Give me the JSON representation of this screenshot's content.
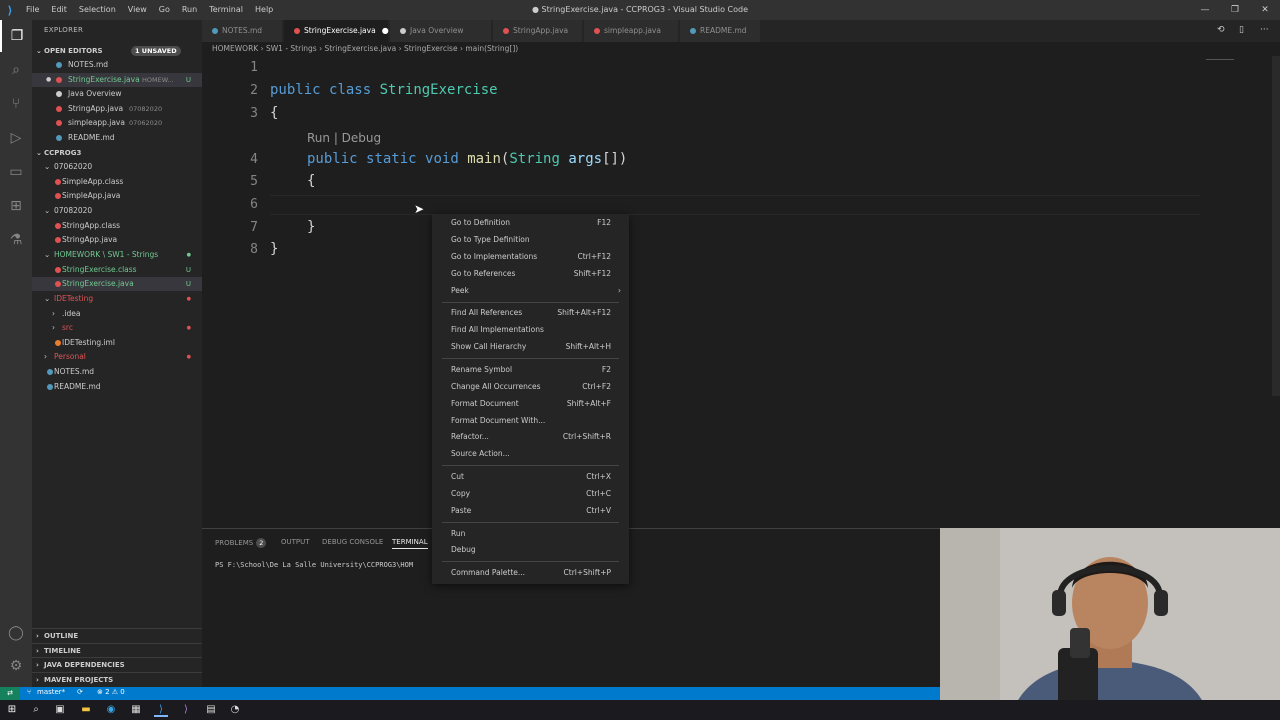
{
  "window": {
    "title": "● StringExercise.java - CCPROG3 - Visual Studio Code",
    "menu": [
      "File",
      "Edit",
      "Selection",
      "View",
      "Go",
      "Run",
      "Terminal",
      "Help"
    ]
  },
  "sidebar": {
    "header": "EXPLORER",
    "open_editors": {
      "label": "OPEN EDITORS",
      "badge": "1 UNSAVED",
      "items": [
        {
          "name": "NOTES.md",
          "detail": "",
          "badge": "",
          "color": "#519aba"
        },
        {
          "name": "StringExercise.java",
          "detail": "HOMEW...",
          "badge": "U",
          "color": "#e05252"
        },
        {
          "name": "Java Overview",
          "detail": "",
          "badge": "",
          "color": "#cccccc"
        },
        {
          "name": "StringApp.java",
          "detail": "07082020",
          "badge": "",
          "color": "#e05252"
        },
        {
          "name": "simpleapp.java",
          "detail": "07062020",
          "badge": "",
          "color": "#e05252"
        },
        {
          "name": "README.md",
          "detail": "",
          "badge": "",
          "color": "#519aba"
        }
      ]
    },
    "workspace": {
      "label": "CCPROG3",
      "items": [
        {
          "name": "07062020",
          "badge": "",
          "kind": "folder"
        },
        {
          "name": "SimpleApp.class",
          "badge": "",
          "kind": "file"
        },
        {
          "name": "SimpleApp.java",
          "badge": "",
          "kind": "file"
        },
        {
          "name": "07082020",
          "badge": "",
          "kind": "folder"
        },
        {
          "name": "StringApp.class",
          "badge": "",
          "kind": "file"
        },
        {
          "name": "StringApp.java",
          "badge": "",
          "kind": "file"
        },
        {
          "name": "HOMEWORK \\ SW1 - Strings",
          "badge": "",
          "kind": "folder"
        },
        {
          "name": "StringExercise.class",
          "badge": "U",
          "kind": "file"
        },
        {
          "name": "StringExercise.java",
          "badge": "U",
          "kind": "file"
        },
        {
          "name": "IDETesting",
          "badge": "",
          "kind": "folder"
        },
        {
          "name": ".idea",
          "badge": "",
          "kind": "folder"
        },
        {
          "name": "src",
          "badge": "",
          "kind": "folder"
        },
        {
          "name": "IDETesting.iml",
          "badge": "",
          "kind": "file"
        },
        {
          "name": "Personal",
          "badge": "",
          "kind": "folder"
        },
        {
          "name": "NOTES.md",
          "badge": "",
          "kind": "file"
        },
        {
          "name": "README.md",
          "badge": "",
          "kind": "file"
        }
      ]
    },
    "bottom_sections": [
      "OUTLINE",
      "TIMELINE",
      "JAVA DEPENDENCIES",
      "MAVEN PROJECTS"
    ]
  },
  "tabs": [
    {
      "label": "NOTES.md",
      "active": false
    },
    {
      "label": "StringExercise.java",
      "active": true,
      "dirty": "●"
    },
    {
      "label": "Java Overview",
      "active": false
    },
    {
      "label": "StringApp.java",
      "active": false
    },
    {
      "label": "simpleapp.java",
      "active": false
    },
    {
      "label": "README.md",
      "active": false
    }
  ],
  "breadcrumb": [
    "HOMEWORK",
    "SW1 - Strings",
    "StringExercise.java",
    "StringExercise",
    "main(String[])"
  ],
  "editor": {
    "line_numbers": [
      "1",
      "2",
      "3",
      "4",
      "5",
      "6",
      "7",
      "8"
    ],
    "code_lens": "Run | Debug",
    "lines": {
      "l2_kw1": "public",
      "l2_kw2": "class",
      "l2_name": "StringExercise",
      "l3": "{",
      "l4_kw1": "public",
      "l4_kw2": "static",
      "l4_kw3": "void",
      "l4_fn": "main",
      "l4_open": "(",
      "l4_type": "String",
      "l4_var": "args",
      "l4_close": "[])",
      "l5": "{",
      "l7": "}",
      "l8": "}"
    }
  },
  "context_menu": {
    "groups": [
      [
        {
          "label": "Go to Definition",
          "key": "F12"
        },
        {
          "label": "Go to Type Definition",
          "key": ""
        },
        {
          "label": "Go to Implementations",
          "key": "Ctrl+F12"
        },
        {
          "label": "Go to References",
          "key": "Shift+F12"
        },
        {
          "label": "Peek",
          "key": "›"
        }
      ],
      [
        {
          "label": "Find All References",
          "key": "Shift+Alt+F12"
        },
        {
          "label": "Find All Implementations",
          "key": ""
        },
        {
          "label": "Show Call Hierarchy",
          "key": "Shift+Alt+H"
        }
      ],
      [
        {
          "label": "Rename Symbol",
          "key": "F2"
        },
        {
          "label": "Change All Occurrences",
          "key": "Ctrl+F2"
        },
        {
          "label": "Format Document",
          "key": "Shift+Alt+F"
        },
        {
          "label": "Format Document With...",
          "key": ""
        },
        {
          "label": "Refactor...",
          "key": "Ctrl+Shift+R"
        },
        {
          "label": "Source Action...",
          "key": ""
        }
      ],
      [
        {
          "label": "Cut",
          "key": "Ctrl+X"
        },
        {
          "label": "Copy",
          "key": "Ctrl+C"
        },
        {
          "label": "Paste",
          "key": "Ctrl+V"
        }
      ],
      [
        {
          "label": "Run",
          "key": ""
        },
        {
          "label": "Debug",
          "key": ""
        }
      ],
      [
        {
          "label": "Command Palette...",
          "key": "Ctrl+Shift+P"
        }
      ]
    ]
  },
  "panel": {
    "tabs": [
      {
        "label": "PROBLEMS",
        "badge": "2"
      },
      {
        "label": "OUTPUT",
        "badge": ""
      },
      {
        "label": "DEBUG CONSOLE",
        "badge": ""
      },
      {
        "label": "TERMINAL",
        "badge": ""
      }
    ],
    "terminal_text": "PS F:\\School\\De La Salle University\\CCPROG3\\HOM"
  },
  "statusbar": {
    "branch": "master*",
    "problems": "⊗ 2 ⚠ 0"
  },
  "colors": {
    "accent": "#007acc",
    "keyword": "#569cd6",
    "type": "#4ec9b0",
    "function": "#dcdcaa",
    "variable": "#9cdcfe",
    "git_untracked": "#73c991",
    "error_file": "#e05252"
  }
}
